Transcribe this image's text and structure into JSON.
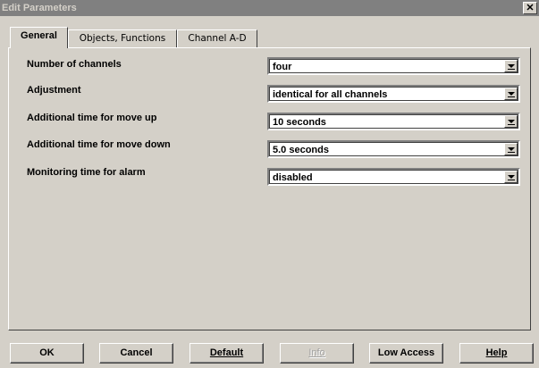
{
  "window": {
    "title": "Edit Parameters",
    "close_label": "✕"
  },
  "tabs": [
    {
      "label": "General",
      "active": true
    },
    {
      "label": "Objects, Functions",
      "active": false
    },
    {
      "label": "Channel A-D",
      "active": false
    }
  ],
  "params": [
    {
      "label": "Number of channels",
      "value": "four"
    },
    {
      "label": "Adjustment",
      "value": "identical for all channels"
    },
    {
      "label": "Additional time for move up",
      "value": "10 seconds"
    },
    {
      "label": "Additional time for move down",
      "value": "5.0 seconds"
    },
    {
      "label": "Monitoring time for alarm",
      "value": "disabled"
    }
  ],
  "buttons": {
    "ok": "OK",
    "cancel": "Cancel",
    "default": "Default",
    "info": "Info",
    "low_access": "Low Access",
    "help": "Help"
  }
}
